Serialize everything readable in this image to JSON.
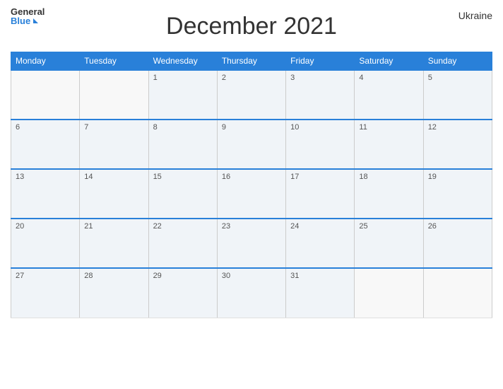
{
  "header": {
    "logo_general": "General",
    "logo_blue": "Blue",
    "month_title": "December 2021",
    "country": "Ukraine"
  },
  "days_of_week": [
    "Monday",
    "Tuesday",
    "Wednesday",
    "Thursday",
    "Friday",
    "Saturday",
    "Sunday"
  ],
  "weeks": [
    [
      {
        "day": "",
        "empty": true
      },
      {
        "day": "",
        "empty": true
      },
      {
        "day": "1"
      },
      {
        "day": "2"
      },
      {
        "day": "3"
      },
      {
        "day": "4"
      },
      {
        "day": "5"
      }
    ],
    [
      {
        "day": "6"
      },
      {
        "day": "7"
      },
      {
        "day": "8"
      },
      {
        "day": "9"
      },
      {
        "day": "10"
      },
      {
        "day": "11"
      },
      {
        "day": "12"
      }
    ],
    [
      {
        "day": "13"
      },
      {
        "day": "14"
      },
      {
        "day": "15"
      },
      {
        "day": "16"
      },
      {
        "day": "17"
      },
      {
        "day": "18"
      },
      {
        "day": "19"
      }
    ],
    [
      {
        "day": "20"
      },
      {
        "day": "21"
      },
      {
        "day": "22"
      },
      {
        "day": "23"
      },
      {
        "day": "24"
      },
      {
        "day": "25"
      },
      {
        "day": "26"
      }
    ],
    [
      {
        "day": "27"
      },
      {
        "day": "28"
      },
      {
        "day": "29"
      },
      {
        "day": "30"
      },
      {
        "day": "31"
      },
      {
        "day": "",
        "empty": true
      },
      {
        "day": "",
        "empty": true
      }
    ]
  ]
}
